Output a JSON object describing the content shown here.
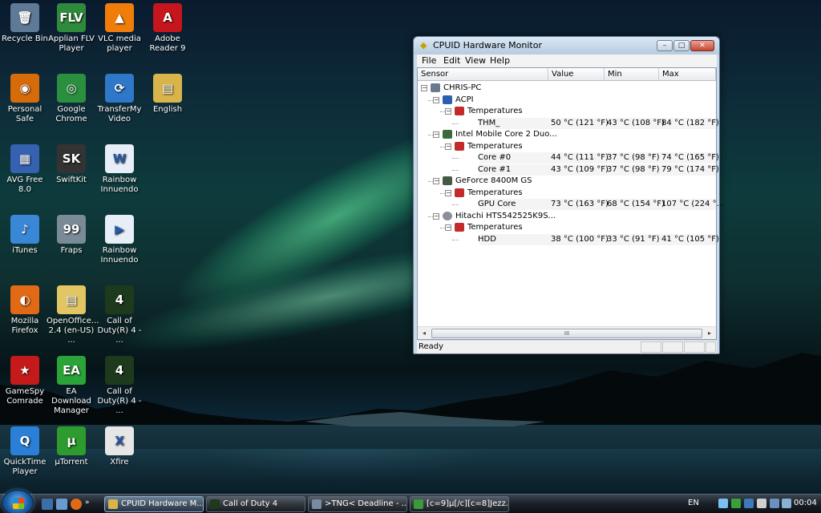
{
  "desktop": {
    "icons": [
      {
        "label": "Recycle Bin",
        "glyph": "🗑",
        "color": "#5e7a96"
      },
      {
        "label": "Applian FLV Player",
        "glyph": "FLV",
        "color": "#2f8a3b"
      },
      {
        "label": "VLC media player",
        "glyph": "▲",
        "color": "#f07d0a"
      },
      {
        "label": "Adobe Reader 9",
        "glyph": "A",
        "color": "#c4161c"
      },
      {
        "label": "Personal Safe",
        "glyph": "◉",
        "color": "#d66b0a"
      },
      {
        "label": "Google Chrome",
        "glyph": "◎",
        "color": "#2a8f3e"
      },
      {
        "label": "TransferMy Video",
        "glyph": "⟳",
        "color": "#2f77c8"
      },
      {
        "label": "English",
        "glyph": "▤",
        "color": "#d8b44a"
      },
      {
        "label": "AVG Free 8.0",
        "glyph": "▦",
        "color": "#3461b0"
      },
      {
        "label": "SwiftKit",
        "glyph": "SK",
        "color": "#333333"
      },
      {
        "label": "Rainbow Innuendo",
        "glyph": "W",
        "color": "#e8eef8"
      },
      {
        "label": "iTunes",
        "glyph": "♪",
        "color": "#3a87d6"
      },
      {
        "label": "Fraps",
        "glyph": "99",
        "color": "#7a8a96"
      },
      {
        "label": "Rainbow Innuendo",
        "glyph": "▶",
        "color": "#e8eef8"
      },
      {
        "label": "Mozilla Firefox",
        "glyph": "◐",
        "color": "#e06a16"
      },
      {
        "label": "OpenOffice... 2.4 (en-US) ...",
        "glyph": "▤",
        "color": "#e3c664"
      },
      {
        "label": "Call of Duty(R) 4 - ...",
        "glyph": "4",
        "color": "#1d3a1d"
      },
      {
        "label": "GameSpy Comrade",
        "glyph": "★",
        "color": "#c41a1a"
      },
      {
        "label": "EA Download Manager",
        "glyph": "EA",
        "color": "#2aa438"
      },
      {
        "label": "Call of Duty(R) 4 - ...",
        "glyph": "4",
        "color": "#1d3a1d"
      },
      {
        "label": "QuickTime Player",
        "glyph": "Q",
        "color": "#2b7fd6"
      },
      {
        "label": "µTorrent",
        "glyph": "µ",
        "color": "#2d9b2d"
      },
      {
        "label": "Xfire",
        "glyph": "X",
        "color": "#e6e6e6"
      }
    ]
  },
  "window": {
    "title": "CPUID Hardware Monitor",
    "controls": {
      "minimize": "–",
      "maximize": "□",
      "close": "✕"
    },
    "menu": [
      "File",
      "Edit",
      "View",
      "Help"
    ],
    "columns": [
      "Sensor",
      "Value",
      "Min",
      "Max"
    ],
    "rows": [
      {
        "label": "CHRIS-PC",
        "level": 0,
        "expander": "−",
        "icon": "computer-icon",
        "value": "",
        "min": "",
        "max": ""
      },
      {
        "label": "ACPI",
        "level": 1,
        "expander": "−",
        "icon": "shield-icon",
        "value": "",
        "min": "",
        "max": ""
      },
      {
        "label": "Temperatures",
        "level": 2,
        "expander": "−",
        "icon": "thermometer-icon",
        "value": "",
        "min": "",
        "max": ""
      },
      {
        "label": "THM_",
        "level": 3,
        "expander": "",
        "icon": "",
        "value": "50 °C  (121 °F)",
        "min": "43 °C  (108 °F)",
        "max": "84 °C  (182 °F)"
      },
      {
        "label": "Intel Mobile Core 2 Duo...",
        "level": 1,
        "expander": "−",
        "icon": "chip-icon",
        "value": "",
        "min": "",
        "max": ""
      },
      {
        "label": "Temperatures",
        "level": 2,
        "expander": "−",
        "icon": "thermometer-icon",
        "value": "",
        "min": "",
        "max": ""
      },
      {
        "label": "Core #0",
        "level": 3,
        "expander": "",
        "icon": "",
        "value": "44 °C  (111 °F)",
        "min": "37 °C  (98 °F)",
        "max": "74 °C  (165 °F)"
      },
      {
        "label": "Core #1",
        "level": 3,
        "expander": "",
        "icon": "",
        "value": "43 °C  (109 °F)",
        "min": "37 °C  (98 °F)",
        "max": "79 °C  (174 °F)"
      },
      {
        "label": "GeForce 8400M GS",
        "level": 1,
        "expander": "−",
        "icon": "gpu-icon",
        "value": "",
        "min": "",
        "max": ""
      },
      {
        "label": "Temperatures",
        "level": 2,
        "expander": "−",
        "icon": "thermometer-icon",
        "value": "",
        "min": "",
        "max": ""
      },
      {
        "label": "GPU Core",
        "level": 3,
        "expander": "",
        "icon": "",
        "value": "73 °C  (163 °F)",
        "min": "68 °C  (154 °F)",
        "max": "107 °C  (224 °..."
      },
      {
        "label": "Hitachi HTS542525K9S...",
        "level": 1,
        "expander": "−",
        "icon": "disk-icon",
        "value": "",
        "min": "",
        "max": ""
      },
      {
        "label": "Temperatures",
        "level": 2,
        "expander": "−",
        "icon": "thermometer-icon",
        "value": "",
        "min": "",
        "max": ""
      },
      {
        "label": "HDD",
        "level": 3,
        "expander": "",
        "icon": "",
        "value": "38 °C  (100 °F)",
        "min": "33 °C  (91 °F)",
        "max": "41 °C  (105 °F)"
      }
    ],
    "scrollbar": {
      "left": "◂",
      "right": "▸",
      "thumb": "III"
    },
    "status": "Ready"
  },
  "taskbar": {
    "tasks": [
      {
        "label": "CPUID Hardware M...",
        "active": true,
        "color": "#d8b44a"
      },
      {
        "label": "Call of Duty 4",
        "active": false,
        "color": "#1d3a1d"
      },
      {
        "label": ">TNG< Deadline - ...",
        "active": false,
        "color": "#7a8aa0"
      },
      {
        "label": "[c=9]µ[/c][c=8]Jezz...",
        "active": false,
        "color": "#3a9a3a"
      }
    ],
    "language": "EN",
    "clock": "00:04"
  }
}
